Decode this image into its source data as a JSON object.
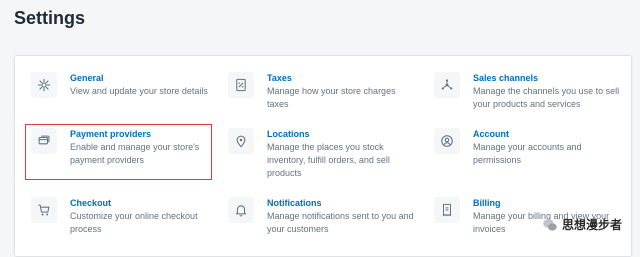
{
  "page": {
    "title": "Settings"
  },
  "settings": [
    {
      "id": "general",
      "icon": "gear-icon",
      "title": "General",
      "description": "View and update your store details"
    },
    {
      "id": "taxes",
      "icon": "tax-receipt-icon",
      "title": "Taxes",
      "description": "Manage how your store charges taxes"
    },
    {
      "id": "sales-channels",
      "icon": "sales-channels-icon",
      "title": "Sales channels",
      "description": "Manage the channels you use to sell your products and services"
    },
    {
      "id": "payment-providers",
      "icon": "payment-card-icon",
      "title": "Payment providers",
      "description": "Enable and manage your store's payment providers"
    },
    {
      "id": "locations",
      "icon": "location-pin-icon",
      "title": "Locations",
      "description": "Manage the places you stock inventory, fulfill orders, and sell products"
    },
    {
      "id": "account",
      "icon": "account-icon",
      "title": "Account",
      "description": "Manage your accounts and permissions"
    },
    {
      "id": "checkout",
      "icon": "shopping-cart-icon",
      "title": "Checkout",
      "description": "Customize your online checkout process"
    },
    {
      "id": "notifications",
      "icon": "bell-icon",
      "title": "Notifications",
      "description": "Manage notifications sent to you and your customers"
    },
    {
      "id": "billing",
      "icon": "invoice-icon",
      "title": "Billing",
      "description": "Manage your billing and view your invoices"
    }
  ],
  "watermark": {
    "text": "思想漫步者"
  },
  "colors": {
    "link": "#006fbb",
    "muted": "#637381",
    "highlight": "#e03b3b"
  }
}
